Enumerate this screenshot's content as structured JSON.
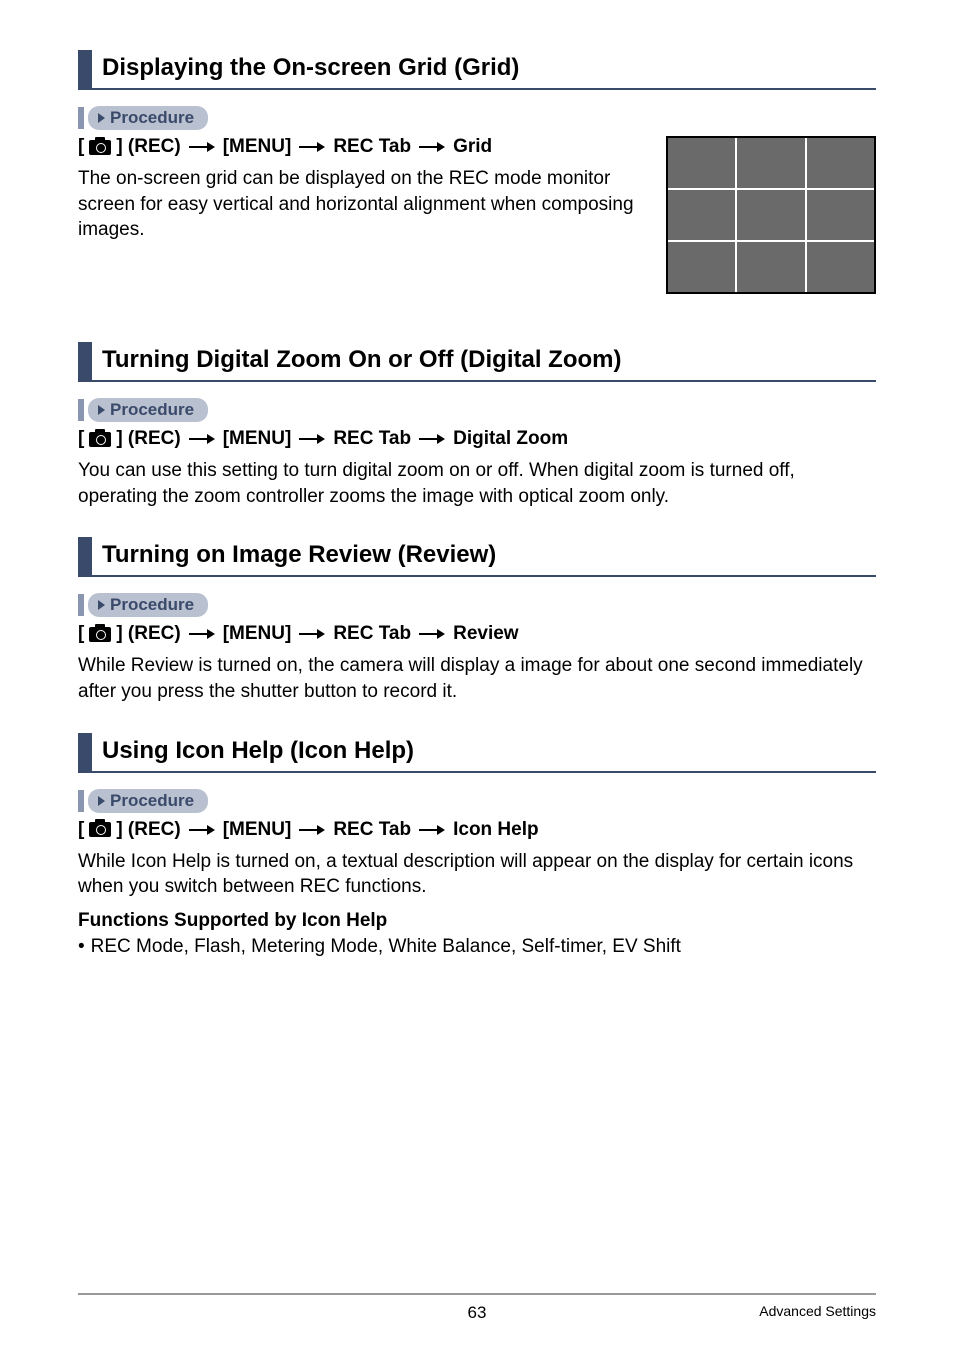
{
  "sections": [
    {
      "title": "Displaying the On-screen Grid (Grid)",
      "procedure_label": "Procedure",
      "path_prefix": "[",
      "path_after_icon": "] (REC)",
      "path_parts": [
        "[MENU]",
        "REC Tab",
        "Grid"
      ],
      "body": "The on-screen grid can be displayed on the REC mode monitor screen for easy vertical and horizontal alignment when composing images."
    },
    {
      "title": "Turning Digital Zoom On or Off (Digital Zoom)",
      "procedure_label": "Procedure",
      "path_prefix": "[",
      "path_after_icon": "] (REC)",
      "path_parts": [
        "[MENU]",
        "REC Tab",
        "Digital Zoom"
      ],
      "body": "You can use this setting to turn digital zoom on or off. When digital zoom is turned off, operating the zoom controller zooms the image with optical zoom only."
    },
    {
      "title": "Turning on Image Review (Review)",
      "procedure_label": "Procedure",
      "path_prefix": "[",
      "path_after_icon": "] (REC)",
      "path_parts": [
        "[MENU]",
        "REC Tab",
        "Review"
      ],
      "body": "While Review is turned on, the camera will display a image for about one second immediately after you press the shutter button to record it."
    },
    {
      "title": "Using Icon Help (Icon Help)",
      "procedure_label": "Procedure",
      "path_prefix": "[",
      "path_after_icon": "] (REC)",
      "path_parts": [
        "[MENU]",
        "REC Tab",
        "Icon Help"
      ],
      "body": "While Icon Help is turned on, a textual description will appear on the display for certain icons when you switch between REC functions.",
      "sub_heading": "Functions Supported by Icon Help",
      "bullet": "REC Mode, Flash, Metering Mode, White Balance, Self-timer, EV Shift"
    }
  ],
  "footer": {
    "page": "63",
    "label": "Advanced Settings"
  }
}
